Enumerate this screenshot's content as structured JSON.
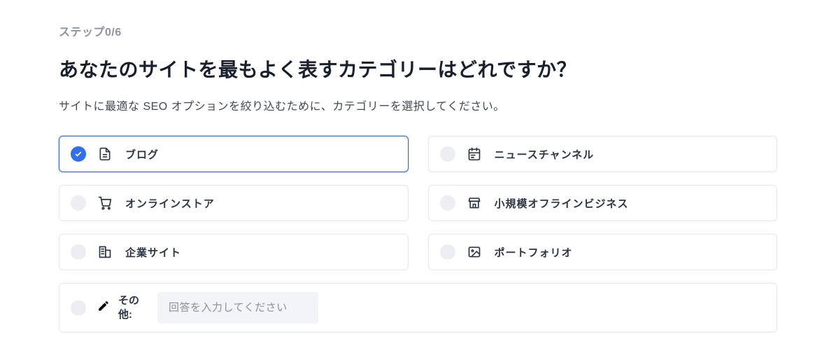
{
  "step_label": "ステップ0/6",
  "heading": "あなたのサイトを最もよく表すカテゴリーはどれですか？",
  "subtext": "サイトに最適な SEO オプションを絞り込むために、カテゴリーを選択してください。",
  "categories": [
    {
      "id": "blog",
      "label": "ブログ",
      "selected": true
    },
    {
      "id": "news",
      "label": "ニュースチャンネル",
      "selected": false
    },
    {
      "id": "store",
      "label": "オンラインストア",
      "selected": false
    },
    {
      "id": "offline",
      "label": "小規模オフラインビジネス",
      "selected": false
    },
    {
      "id": "corporate",
      "label": "企業サイト",
      "selected": false
    },
    {
      "id": "portfolio",
      "label": "ポートフォリオ",
      "selected": false
    }
  ],
  "other": {
    "label": "その他:",
    "placeholder": "回答を入力してください",
    "value": ""
  }
}
